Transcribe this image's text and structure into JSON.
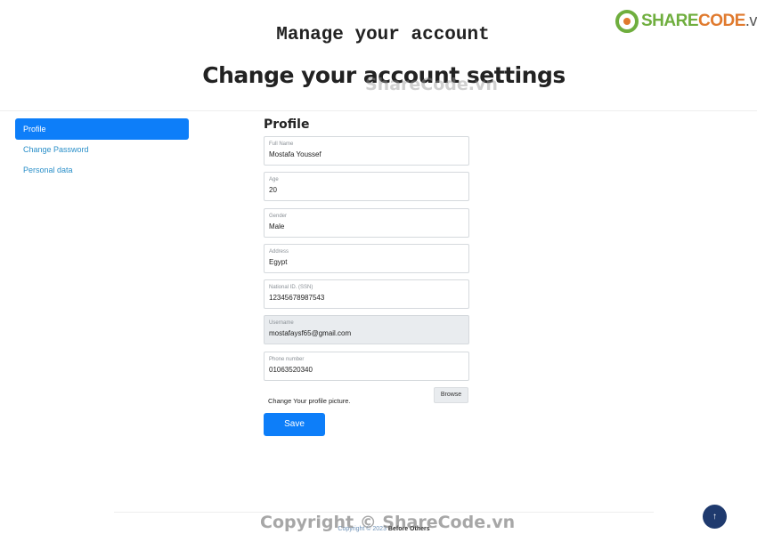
{
  "logo": {
    "share": "SHARE",
    "code": "CODE",
    "vn": ".vn"
  },
  "header": {
    "manage_title": "Manage your account",
    "settings_title": "Change your account settings",
    "watermark": "ShareCode.vn"
  },
  "sidebar": {
    "items": [
      {
        "label": "Profile",
        "active": true
      },
      {
        "label": "Change Password",
        "active": false
      },
      {
        "label": "Personal data",
        "active": false
      }
    ]
  },
  "profile": {
    "heading": "Profile",
    "fields": [
      {
        "label": "Full Name",
        "value": "Mostafa Youssef"
      },
      {
        "label": "Age",
        "value": "20"
      },
      {
        "label": "Gender",
        "value": "Male"
      },
      {
        "label": "Address",
        "value": "Egypt"
      },
      {
        "label": "National ID. (SSN)",
        "value": "12345678987543"
      },
      {
        "label": "Username",
        "value": "mostafaysf65@gmail.com",
        "readonly": true
      },
      {
        "label": "Phone number",
        "value": "01063520340"
      }
    ],
    "picture_label": "Change Your profile picture.",
    "browse_label": "Browse",
    "save_label": "Save"
  },
  "footer": {
    "copyright": "Copyright © 2023",
    "brand": "Before Others",
    "watermark": "Copyright © ShareCode.vn"
  },
  "scroll_top": {
    "icon": "arrow-up-icon",
    "glyph": "↑"
  },
  "colors": {
    "primary": "#0d7ef9",
    "link": "#2a8fc9",
    "scroll_top_bg": "#1f3a6e"
  }
}
